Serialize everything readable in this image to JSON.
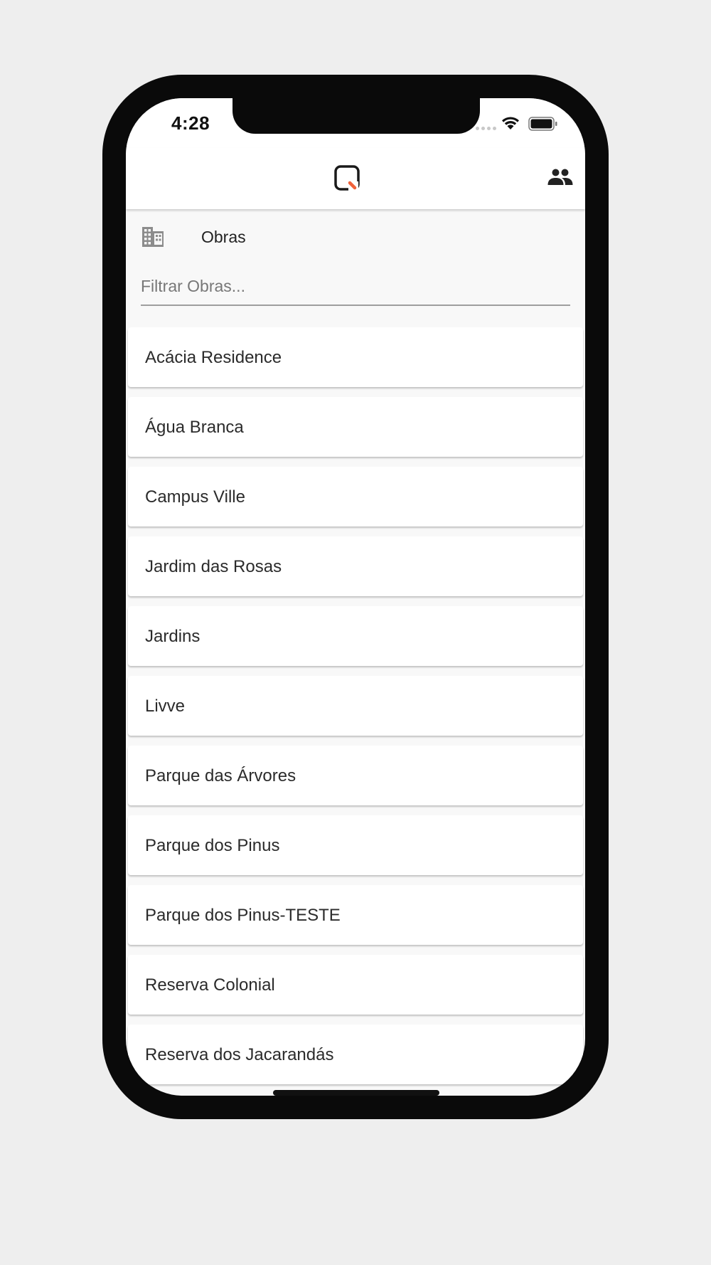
{
  "status_bar": {
    "time": "4:28"
  },
  "app_bar": {
    "logo_icon": "app-logo-icon",
    "accent_color": "#f0623a",
    "people_icon": "people-icon"
  },
  "section": {
    "icon": "building-icon",
    "title": "Obras"
  },
  "filter": {
    "placeholder": "Filtrar Obras...",
    "value": ""
  },
  "obras": [
    {
      "label": "Acácia Residence"
    },
    {
      "label": "Água Branca"
    },
    {
      "label": "Campus Ville"
    },
    {
      "label": "Jardim das Rosas"
    },
    {
      "label": "Jardins"
    },
    {
      "label": "Livve"
    },
    {
      "label": "Parque das Árvores"
    },
    {
      "label": "Parque dos Pinus"
    },
    {
      "label": "Parque dos Pinus-TESTE"
    },
    {
      "label": "Reserva Colonial"
    },
    {
      "label": "Reserva dos Jacarandás"
    }
  ]
}
